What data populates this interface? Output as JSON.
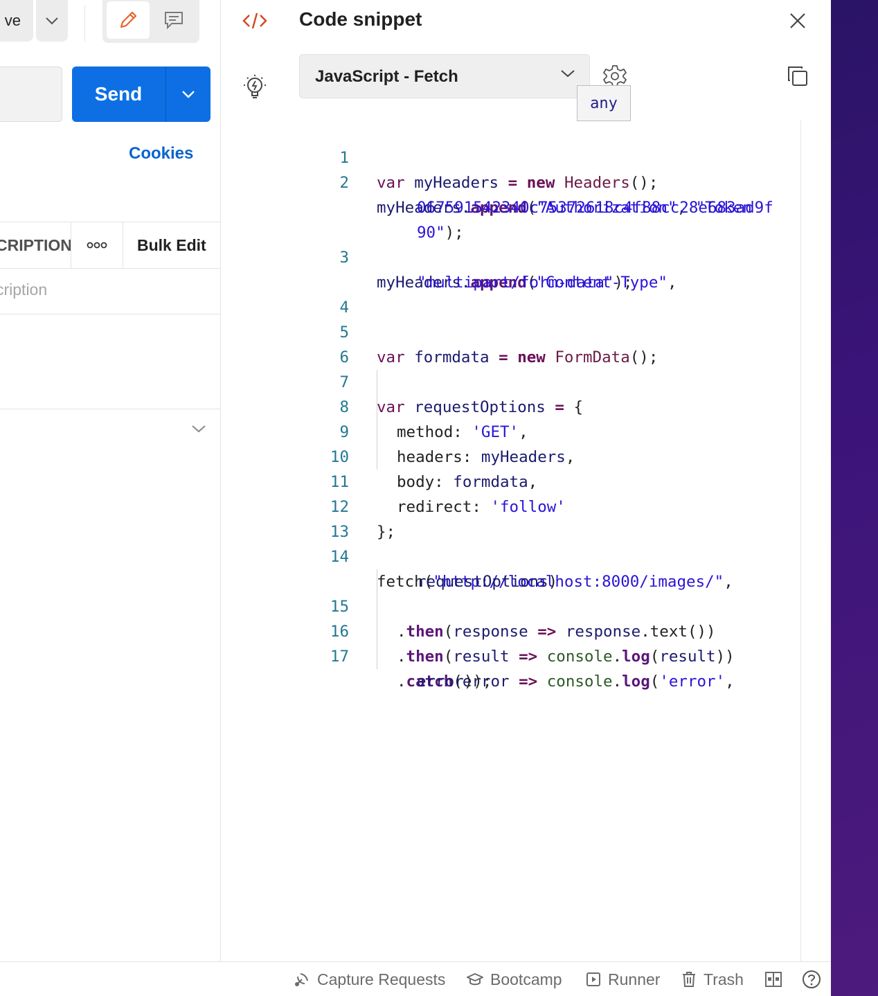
{
  "toolbar": {
    "save_label": "ve"
  },
  "request": {
    "send_label": "Send",
    "cookies_label": "Cookies"
  },
  "params_table": {
    "description_header": "CRIPTION",
    "bulk_edit_label": "Bulk Edit",
    "description_placeholder": "cription"
  },
  "snippet": {
    "title": "Code snippet",
    "language": "JavaScript - Fetch",
    "tooltip": "any"
  },
  "code_lines": [
    {
      "n": "1"
    },
    {
      "n": "2"
    },
    {
      "n": "3"
    },
    {
      "n": "4"
    },
    {
      "n": "5"
    },
    {
      "n": "6"
    },
    {
      "n": "7"
    },
    {
      "n": "8"
    },
    {
      "n": "9"
    },
    {
      "n": "10"
    },
    {
      "n": "11"
    },
    {
      "n": "12"
    },
    {
      "n": "13"
    },
    {
      "n": "14"
    },
    {
      "n": "15"
    },
    {
      "n": "16"
    },
    {
      "n": "17"
    }
  ],
  "code_text": {
    "l1": [
      "var",
      " ",
      "myHeaders",
      " ",
      "=",
      " ",
      "new",
      " ",
      "Headers",
      "();"
    ],
    "l2a": [
      "myHeaders",
      ".",
      "append",
      "(",
      "\"Authorization\"",
      ", ",
      "\"Token"
    ],
    "l2b": "067591542340c75372618c4f88cc28e683ad9f",
    "l2c": [
      "90\"",
      ");"
    ],
    "l3a": [
      "myHeaders",
      ".",
      "append",
      "(",
      "\"Content-Type\"",
      ","
    ],
    "l3b": [
      "\"multipart/form-data\"",
      ");"
    ],
    "l5": [
      "var",
      " ",
      "formdata",
      " ",
      "=",
      " ",
      "new",
      " ",
      "FormData",
      "();"
    ],
    "l7": [
      "var",
      " ",
      "requestOptions",
      " ",
      "=",
      " {"
    ],
    "l8": [
      "method: ",
      "'GET'",
      ","
    ],
    "l9": [
      "headers: ",
      "myHeaders",
      ","
    ],
    "l10": [
      "body: ",
      "formdata",
      ","
    ],
    "l11": [
      "redirect: ",
      "'follow'"
    ],
    "l12": "};",
    "l14a": [
      "fetch",
      "(",
      "\"http://localhost:8000/images/\"",
      ","
    ],
    "l14b": [
      "requestOptions",
      ")"
    ],
    "l15": [
      ".",
      "then",
      "(",
      "response",
      " ",
      "=>",
      " ",
      "response",
      ".",
      "text",
      "())"
    ],
    "l16": [
      ".",
      "then",
      "(",
      "result",
      " ",
      "=>",
      " ",
      "console",
      ".",
      "log",
      "(",
      "result",
      "))"
    ],
    "l17a": [
      ".",
      "catch",
      "(",
      "error",
      " ",
      "=>",
      " ",
      "console",
      ".",
      "log",
      "(",
      "'error'",
      ","
    ],
    "l17b": [
      "error",
      "));"
    ]
  },
  "statusbar": {
    "capture": "Capture Requests",
    "bootcamp": "Bootcamp",
    "runner": "Runner",
    "trash": "Trash"
  },
  "icons": [
    "chevron-down-icon",
    "pencil-icon",
    "comment-icon",
    "more-icon",
    "code-icon",
    "lightbulb-icon",
    "close-icon",
    "gear-icon",
    "copy-icon",
    "satellite-icon",
    "graduation-cap-icon",
    "play-icon",
    "trash-icon",
    "two-pane-icon",
    "help-icon"
  ],
  "colors": {
    "send": "#0d6fe3",
    "link": "#0b63cd",
    "accent": "#e8622e",
    "desktop": "#3b1479"
  }
}
